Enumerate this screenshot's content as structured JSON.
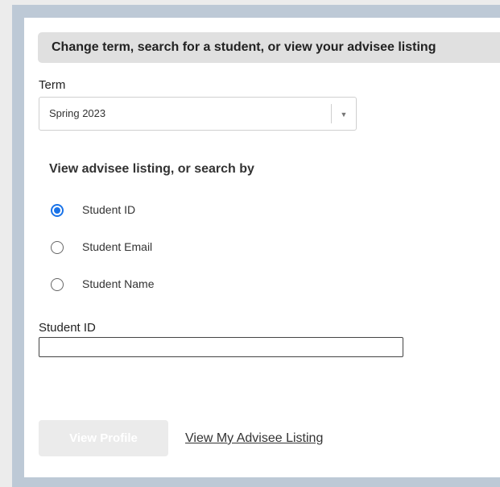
{
  "header": {
    "title": "Change term, search for a student, or view your advisee listing"
  },
  "term": {
    "label": "Term",
    "selected": "Spring 2023"
  },
  "search": {
    "heading": "View advisee listing, or search by",
    "options": [
      {
        "label": "Student ID",
        "selected": true
      },
      {
        "label": "Student Email",
        "selected": false
      },
      {
        "label": "Student Name",
        "selected": false
      }
    ]
  },
  "field": {
    "label": "Student ID",
    "value": ""
  },
  "actions": {
    "view_profile_label": "View Profile",
    "advisee_link_label": "View My Advisee Listing"
  },
  "colors": {
    "accent": "#1a73e8",
    "frame": "#bdc9d6",
    "header_bg": "#e0e0e0"
  }
}
